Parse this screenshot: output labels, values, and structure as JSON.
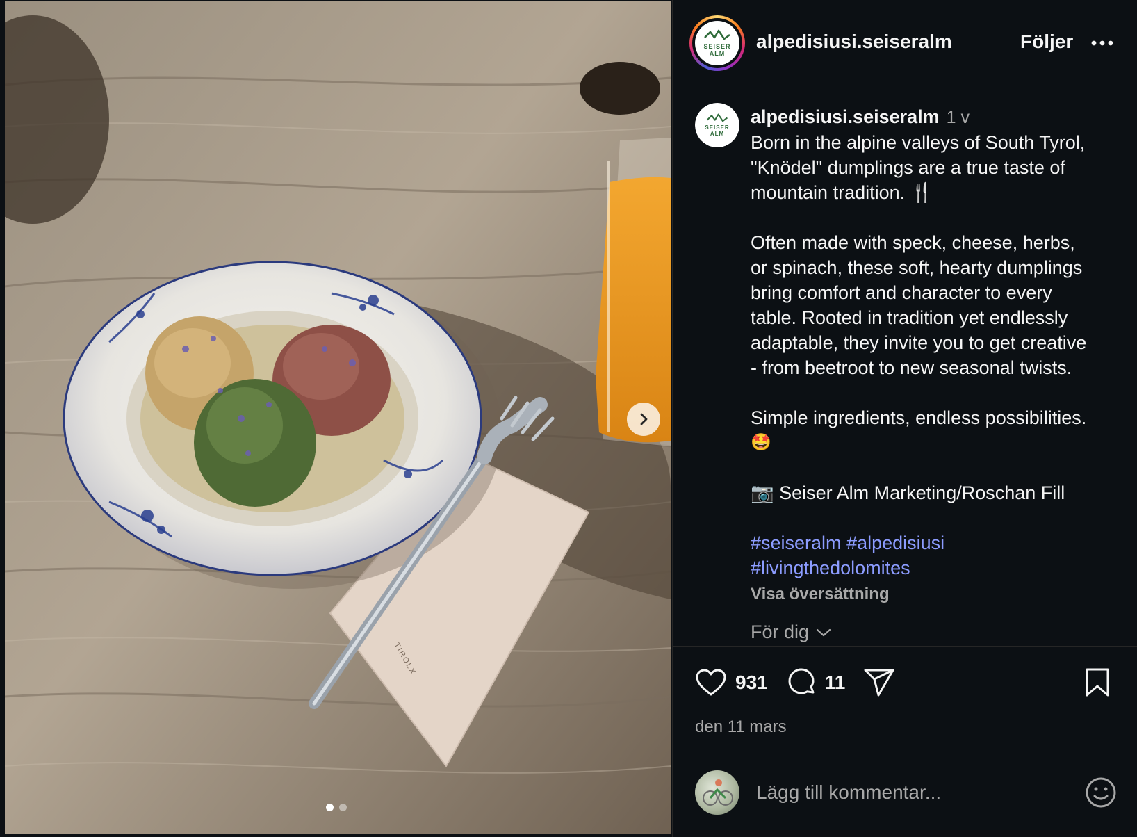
{
  "post": {
    "username": "alpedisiusi.seiseralm",
    "follow_label": "Följer",
    "logo_text_1": "SEISER",
    "logo_text_2": "ALM",
    "time_ago": "1 v",
    "caption_lines_1": [
      "Born in the alpine valleys of South Tyrol,",
      "\"Knödel\" dumplings are a true taste of",
      "mountain tradition. 🍴"
    ],
    "caption_lines_2": [
      "Often made with speck, cheese, herbs,",
      "or spinach, these soft, hearty dumplings",
      "bring comfort and character to every",
      "table. Rooted in tradition yet endlessly",
      "adaptable, they invite you to get creative",
      "- from beetroot to new seasonal twists."
    ],
    "caption_lines_3": [
      "Simple ingredients, endless possibilities.",
      "🤩"
    ],
    "credit": "📷 Seiser Alm Marketing/Roschan Fill",
    "hashtags": [
      "#seiseralm",
      "#alpedisiusi",
      "#livingthedolomites"
    ],
    "translate_label": "Visa översättning",
    "for_you_label": "För dig",
    "likes": "931",
    "comments": "11",
    "date": "den 11 mars",
    "comment_placeholder": "Lägg till kommentar..."
  },
  "carousel": {
    "current": 1,
    "total": 2
  },
  "napkin_print": "TIROLX",
  "colors": {
    "background": "#0c1014",
    "hashtag": "#8c9cff",
    "muted": "#a8a8a8",
    "logo_green": "#2f6b3a"
  },
  "icons": [
    "more-icon",
    "heart-icon",
    "comment-icon",
    "share-icon",
    "bookmark-icon",
    "chevron-down-icon",
    "emoji-icon",
    "chevron-right-icon"
  ]
}
